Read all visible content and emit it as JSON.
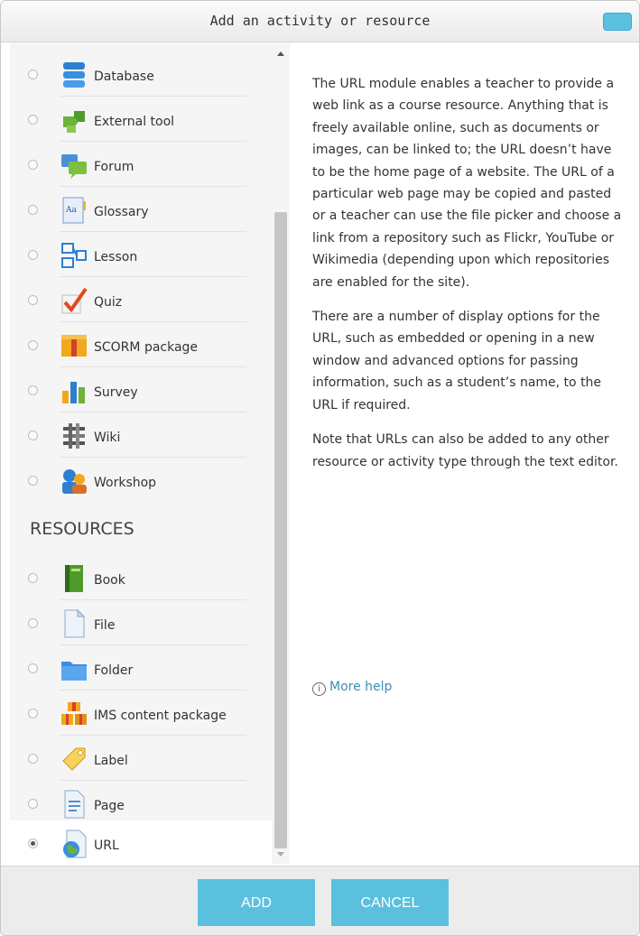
{
  "dialog": {
    "title": "Add an activity or resource"
  },
  "activities": [
    {
      "label": "Database",
      "icon": "database-icon"
    },
    {
      "label": "External tool",
      "icon": "puzzle-icon"
    },
    {
      "label": "Forum",
      "icon": "forum-icon"
    },
    {
      "label": "Glossary",
      "icon": "glossary-icon"
    },
    {
      "label": "Lesson",
      "icon": "lesson-icon"
    },
    {
      "label": "Quiz",
      "icon": "quiz-checkmark-icon"
    },
    {
      "label": "SCORM package",
      "icon": "scorm-package-icon"
    },
    {
      "label": "Survey",
      "icon": "survey-chart-icon"
    },
    {
      "label": "Wiki",
      "icon": "wiki-icon"
    },
    {
      "label": "Workshop",
      "icon": "workshop-people-icon"
    }
  ],
  "resources_heading": "RESOURCES",
  "resources": [
    {
      "label": "Book",
      "icon": "book-icon"
    },
    {
      "label": "File",
      "icon": "file-icon"
    },
    {
      "label": "Folder",
      "icon": "folder-icon"
    },
    {
      "label": "IMS content package",
      "icon": "ims-package-icon"
    },
    {
      "label": "Label",
      "icon": "label-tag-icon"
    },
    {
      "label": "Page",
      "icon": "page-icon"
    },
    {
      "label": "URL",
      "icon": "url-globe-icon",
      "selected": true
    }
  ],
  "description": {
    "p1": "The URL module enables a teacher to provide a web link as a course resource. Anything that is freely available online, such as documents or images, can be linked to; the URL doesn’t have to be the home page of a website. The URL of a particular web page may be copied and pasted or a teacher can use the file picker and choose a link from a repository such as Flickr, YouTube or Wikimedia (depending upon which repositories are enabled for the site).",
    "p2": "There are a number of display options for the URL, such as embedded or opening in a new window and advanced options for passing information, such as a student’s name, to the URL if required.",
    "p3": "Note that URLs can also be added to any other resource or activity type through the text editor.",
    "more_help": "More help",
    "info_glyph": "i"
  },
  "footer": {
    "add_label": "ADD",
    "cancel_label": "CANCEL"
  },
  "colors": {
    "accent": "#5bc0de",
    "link": "#3a8fb7"
  }
}
